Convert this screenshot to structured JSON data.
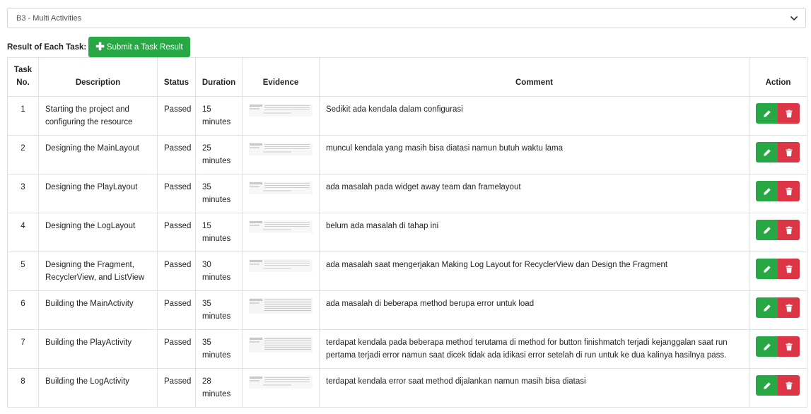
{
  "activity_select": {
    "selected": "B3 - Multi Activities"
  },
  "result_section": {
    "label": "Result of Each Task:",
    "submit_label": "Submit a Task Result"
  },
  "table": {
    "headers": {
      "task_no_line1": "Task",
      "task_no_line2": "No.",
      "description": "Description",
      "status": "Status",
      "duration": "Duration",
      "evidence": "Evidence",
      "comment": "Comment",
      "action": "Action"
    },
    "rows": [
      {
        "no": "1",
        "description": "Starting the project and configuring the resource",
        "status": "Passed",
        "duration": "15 minutes",
        "comment": "Sedikit ada kendala dalam configurasi"
      },
      {
        "no": "2",
        "description": "Designing the MainLayout",
        "status": "Passed",
        "duration": "25 minutes",
        "comment": "muncul kendala yang masih bisa diatasi namun butuh waktu lama"
      },
      {
        "no": "3",
        "description": "Designing the PlayLayout",
        "status": "Passed",
        "duration": "35 minutes",
        "comment": "ada masalah pada widget away team dan framelayout"
      },
      {
        "no": "4",
        "description": "Designing the LogLayout",
        "status": "Passed",
        "duration": "15 minutes",
        "comment": "belum ada masalah di tahap ini"
      },
      {
        "no": "5",
        "description": "Designing the Fragment, RecyclerView, and ListView",
        "status": "Passed",
        "duration": "30 minutes",
        "comment": "ada masalah saat mengerjakan Making Log Layout for RecyclerView dan Design the Fragment"
      },
      {
        "no": "6",
        "description": "Building the MainActivity",
        "status": "Passed",
        "duration": "35 minutes",
        "comment": "ada masalah di beberapa method berupa error untuk load"
      },
      {
        "no": "7",
        "description": "Building the PlayActivity",
        "status": "Passed",
        "duration": "35 minutes",
        "comment": "terdapat kendala pada beberapa method terutama di method for button finishmatch terjadi kejanggalan saat run pertama terjadi error namun saat dicek tidak ada idikasi error setelah di run untuk ke dua kalinya hasilnya pass."
      },
      {
        "no": "8",
        "description": "Building the LogActivity",
        "status": "Passed",
        "duration": "28 minutes",
        "comment": "terdapat kendala error saat method dijalankan namun masih bisa diatasi"
      }
    ]
  },
  "colors": {
    "success": "#28a745",
    "danger": "#dc3545",
    "border": "#dee2e6"
  },
  "icons": {
    "edit": "pencil-icon",
    "delete": "trash-icon",
    "dropdown": "chevron-down-icon",
    "submit": "plus-icon"
  }
}
